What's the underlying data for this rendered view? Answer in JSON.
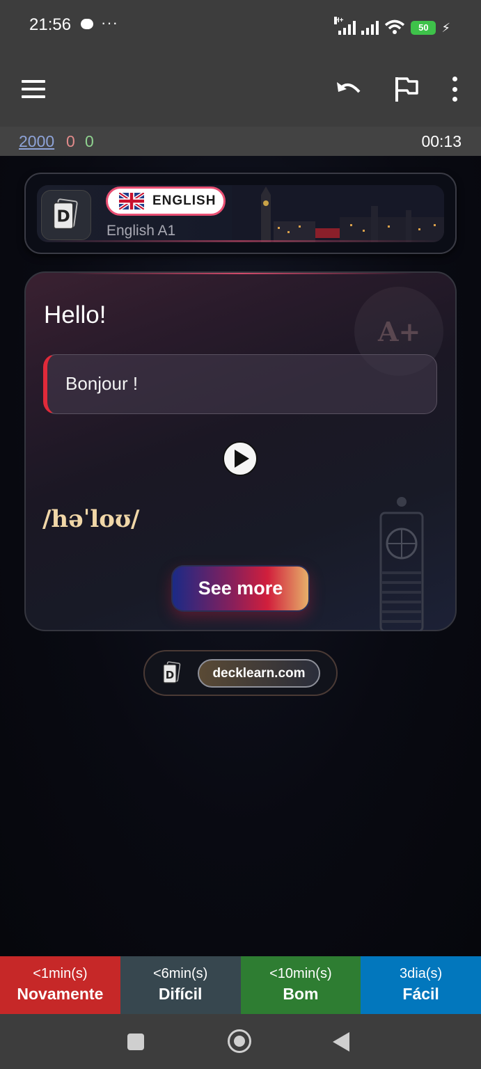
{
  "status_bar": {
    "time": "21:56",
    "more": "···",
    "network_type": "H+",
    "battery": "50"
  },
  "icons": {
    "menu": "menu-icon",
    "undo": "undo-icon",
    "flag": "flag-icon",
    "more": "more-vert-icon",
    "play": "play-icon"
  },
  "counts": {
    "new": "2000",
    "learning": "0",
    "review": "0",
    "timer": "00:13"
  },
  "deck": {
    "language": "ENGLISH",
    "name": "English A1"
  },
  "card": {
    "word": "Hello!",
    "translation": "Bonjour !",
    "phonetic": "/həˈloʊ/",
    "see_more": "See more",
    "badge": "A+"
  },
  "site": {
    "link": "decklearn.com"
  },
  "answers": [
    {
      "time": "<1min(s)",
      "label": "Novamente",
      "color": "#c62828"
    },
    {
      "time": "<6min(s)",
      "label": "Difícil",
      "color": "#37474f"
    },
    {
      "time": "<10min(s)",
      "label": "Bom",
      "color": "#2e7d32"
    },
    {
      "time": "3dia(s)",
      "label": "Fácil",
      "color": "#0277bd"
    }
  ]
}
